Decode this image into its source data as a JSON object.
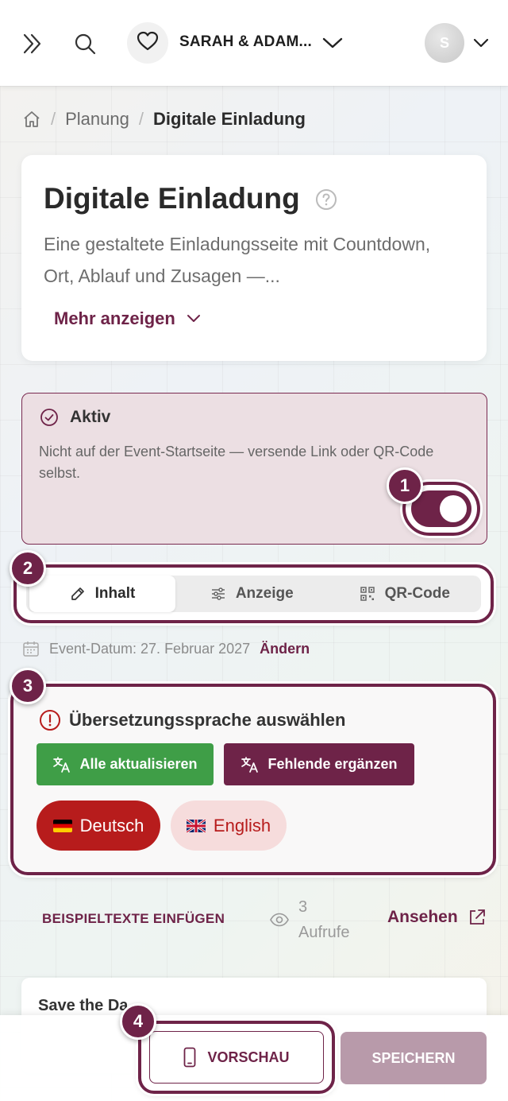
{
  "header": {
    "event_name": "SARAH & ADAM...",
    "avatar_initial": "S"
  },
  "breadcrumb": {
    "parent": "Planung",
    "current": "Digitale Einladung"
  },
  "intro": {
    "title": "Digitale Einladung",
    "description": "Eine gestaltete Einladungsseite mit Countdown, Ort, Ablauf und Zusagen —...",
    "more_label": "Mehr anzeigen"
  },
  "status": {
    "title": "Aktiv",
    "text": "Nicht auf der Event-Startseite — versende Link oder QR-Code selbst.",
    "toggle_on": true
  },
  "badges": [
    "1",
    "2",
    "3",
    "4"
  ],
  "tabs": [
    {
      "label": "Inhalt",
      "icon": "edit-icon",
      "active": true
    },
    {
      "label": "Anzeige",
      "icon": "sliders-icon",
      "active": false
    },
    {
      "label": "QR-Code",
      "icon": "qr-code-icon",
      "active": false
    }
  ],
  "event_date": {
    "label": "Event-Datum: 27. Februar 2027",
    "change_label": "Ändern"
  },
  "translation": {
    "title": "Übersetzungssprache auswählen",
    "update_all": "Alle aktualisieren",
    "fill_missing": "Fehlende ergänzen",
    "languages": [
      {
        "label": "Deutsch",
        "selected": true
      },
      {
        "label": "English",
        "selected": false
      }
    ]
  },
  "actions": {
    "sample_texts": "BEISPIELTEXTE EINFÜGEN",
    "views_count": "3",
    "views_label": "Aufrufe",
    "view_label": "Ansehen"
  },
  "section": {
    "title": "Save the Da"
  },
  "footer": {
    "preview_label": "VORSCHAU",
    "save_label": "SPEICHERN"
  },
  "colors": {
    "accent": "#6e2348",
    "success": "#3f9e47",
    "danger": "#b71c1c",
    "disabled": "#b89aaa"
  }
}
